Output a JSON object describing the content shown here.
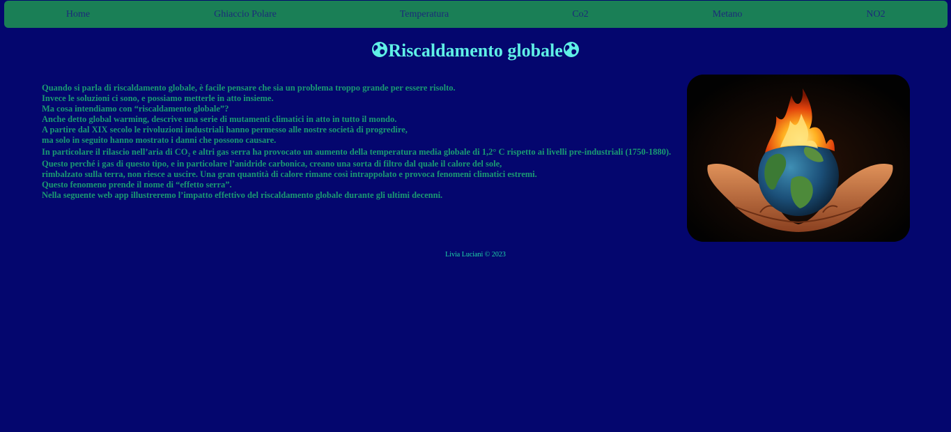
{
  "nav": {
    "items": [
      {
        "label": "Home"
      },
      {
        "label": "Ghiaccio Polare"
      },
      {
        "label": "Temperatura"
      },
      {
        "label": "Co2"
      },
      {
        "label": "Metano"
      },
      {
        "label": "NO2"
      }
    ]
  },
  "header": {
    "title": "Riscaldamento globale"
  },
  "main": {
    "paragraph_lines": [
      "Quando si parla di riscaldamento globale, è facile pensare che sia un problema troppo grande per essere risolto.",
      "Invece le soluzioni ci sono, e possiamo metterle in atto insieme.",
      "Ma cosa intendiamo con “riscaldamento globale”?",
      "Anche detto global warming, descrive una serie di mutamenti climatici in atto in tutto il mondo.",
      "A partire dal XIX secolo le rivoluzioni industriali hanno permesso alle nostre società di progredire,",
      "ma solo in seguito hanno mostrato i danni che possono causare.",
      "In particolare il rilascio nell’aria di CO₂ e altri gas serra ha provocato un aumento della temperatura media globale di 1,2° C rispetto ai livelli pre-industriali (1750-1880).",
      "Questo perché i gas di questo tipo, e in particolare l’anidride carbonica, creano una sorta di filtro dal quale il calore del sole,",
      "rimbalzato sulla terra, non riesce a uscire. Una gran quantità di calore rimane così intrappolato e provoca fenomeni climatici estremi.",
      "Questo fenomeno prende il nome di “effetto serra”.",
      "Nella seguente web app illustreremo l’impatto effettivo del riscaldamento globale durante gli ultimi decenni."
    ]
  },
  "footer": {
    "text": "Livia Luciani © 2023"
  },
  "colors": {
    "background": "#04066e",
    "navbar": "#1a7f56",
    "title": "#5ff0e6",
    "body_text": "#1a9a72",
    "footer_text": "#1fd6a8"
  },
  "icons": [
    "globe-icon",
    "burning-earth-in-hands-image"
  ]
}
